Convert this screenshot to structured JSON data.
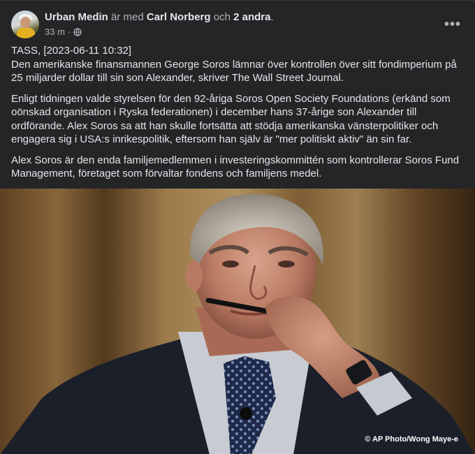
{
  "post": {
    "author": "Urban Medin",
    "with_text": "är med",
    "tagged": "Carl Norberg",
    "and_text": "och",
    "others": "2 andra",
    "period": ".",
    "time": "33 m",
    "separator": "·",
    "privacy_icon": "globe-icon",
    "more_icon": "more-options-icon",
    "more_label": "•••",
    "paragraphs": [
      "TASS, [2023-06-11 10:32]",
      "Den amerikanske finansmannen George Soros lämnar över kontrollen över sitt fondimperium på 25 miljarder dollar till sin son Alexander, skriver The Wall Street Journal.",
      "Enligt tidningen valde styrelsen för den 92-åriga Soros Open Society Foundations (erkänd som oönskad organisation i Ryska federationen) i december hans 37-årige son Alexander till ordförande. Alex Soros sa att han skulle fortsätta att stödja amerikanska vänsterpolitiker och engagera sig i USA:s inrikespolitik, eftersom han själv är \"mer politiskt aktiv\" än sin far.",
      "Alex Soros är den enda familjemedlemmen i investeringskommittén som kontrollerar Soros Fund Management, företaget som förvaltar fondens och familjens medel."
    ],
    "photo_credit": "© AP Photo/Wong Maye-e"
  },
  "colors": {
    "card_bg": "#242526",
    "text_primary": "#e4e6eb",
    "text_secondary": "#b0b3b8"
  }
}
